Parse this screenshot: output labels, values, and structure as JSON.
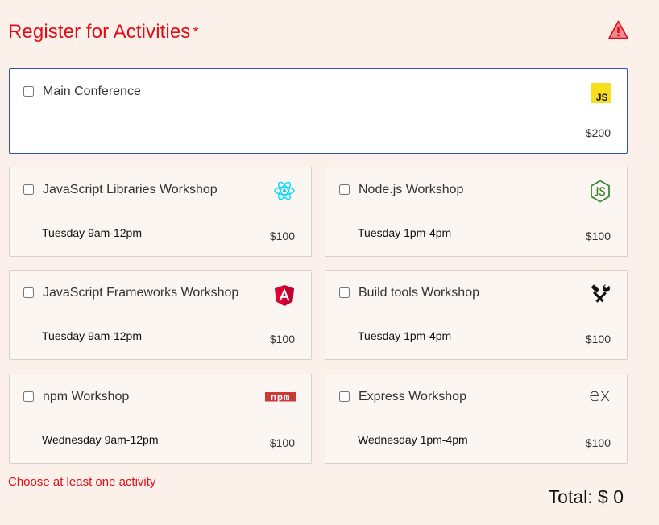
{
  "header": {
    "title": "Register for Activities",
    "required_marker": "*"
  },
  "activities": [
    {
      "name": "Main Conference",
      "time": "",
      "price": "$200",
      "icon": "javascript-icon",
      "selected": false
    },
    {
      "name": "JavaScript Libraries Workshop",
      "time": "Tuesday 9am-12pm",
      "price": "$100",
      "icon": "react-icon",
      "selected": false
    },
    {
      "name": "Node.js Workshop",
      "time": "Tuesday 1pm-4pm",
      "price": "$100",
      "icon": "nodejs-icon",
      "selected": false
    },
    {
      "name": "JavaScript Frameworks Workshop",
      "time": "Tuesday 9am-12pm",
      "price": "$100",
      "icon": "angular-icon",
      "selected": false
    },
    {
      "name": "Build tools Workshop",
      "time": "Tuesday 1pm-4pm",
      "price": "$100",
      "icon": "tools-icon",
      "selected": false
    },
    {
      "name": "npm Workshop",
      "time": "Wednesday 9am-12pm",
      "price": "$100",
      "icon": "npm-icon",
      "selected": false
    },
    {
      "name": "Express Workshop",
      "time": "Wednesday 1pm-4pm",
      "price": "$100",
      "icon": "express-icon",
      "selected": false
    }
  ],
  "logos": {
    "javascript": "JS",
    "npm": "npm",
    "express": "ex"
  },
  "validation": {
    "error": "Choose at least one activity"
  },
  "total": {
    "label": "Total: $ 0"
  },
  "colors": {
    "accent_red": "#e10d16",
    "background": "#fbf1ea",
    "focus_border": "#2e4fc1",
    "js_yellow": "#f7df1e",
    "react_cyan": "#00d8ff",
    "node_green": "#3c873a",
    "angular_red": "#dd0031",
    "npm_red": "#cb3837"
  }
}
